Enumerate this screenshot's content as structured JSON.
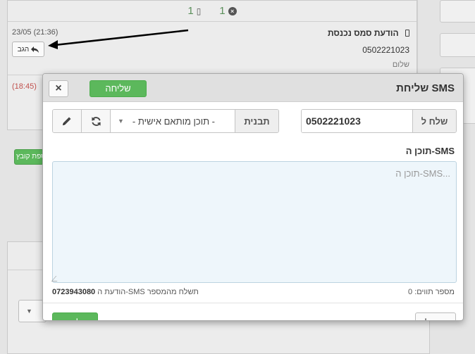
{
  "background": {
    "counts": [
      {
        "value": "1",
        "icon": "phone-icon"
      },
      {
        "value": "1",
        "icon": "times-circle-icon"
      }
    ],
    "messages": [
      {
        "title": "הודעת סמס נכנסת",
        "time": "23/05 (21:36)",
        "phone": "0502221023",
        "body": "שלום",
        "reply_label": "הגב"
      },
      {
        "time": "(18:45)"
      }
    ],
    "file_button": "הוספת קובץ"
  },
  "modal": {
    "title": "שליחת SMS",
    "send_label": "שליחה",
    "to_label": "שלח ל",
    "to_value": "0502221023",
    "template_label": "תבנית",
    "template_value": "- תוכן מותאם אישית -",
    "content_label": "תוכן ה-SMS",
    "content_placeholder": "תוכן ה-SMS...",
    "char_count_label": "מספר תווים: 0",
    "from_note_prefix": "הודעת ה-SMS תשלח מהמספר",
    "from_number": "0723943080",
    "cancel_label": "ביטול"
  },
  "colors": {
    "send_green": "#5cb85c",
    "error_red": "#c0504d",
    "textarea_bg": "#eef6fb"
  }
}
